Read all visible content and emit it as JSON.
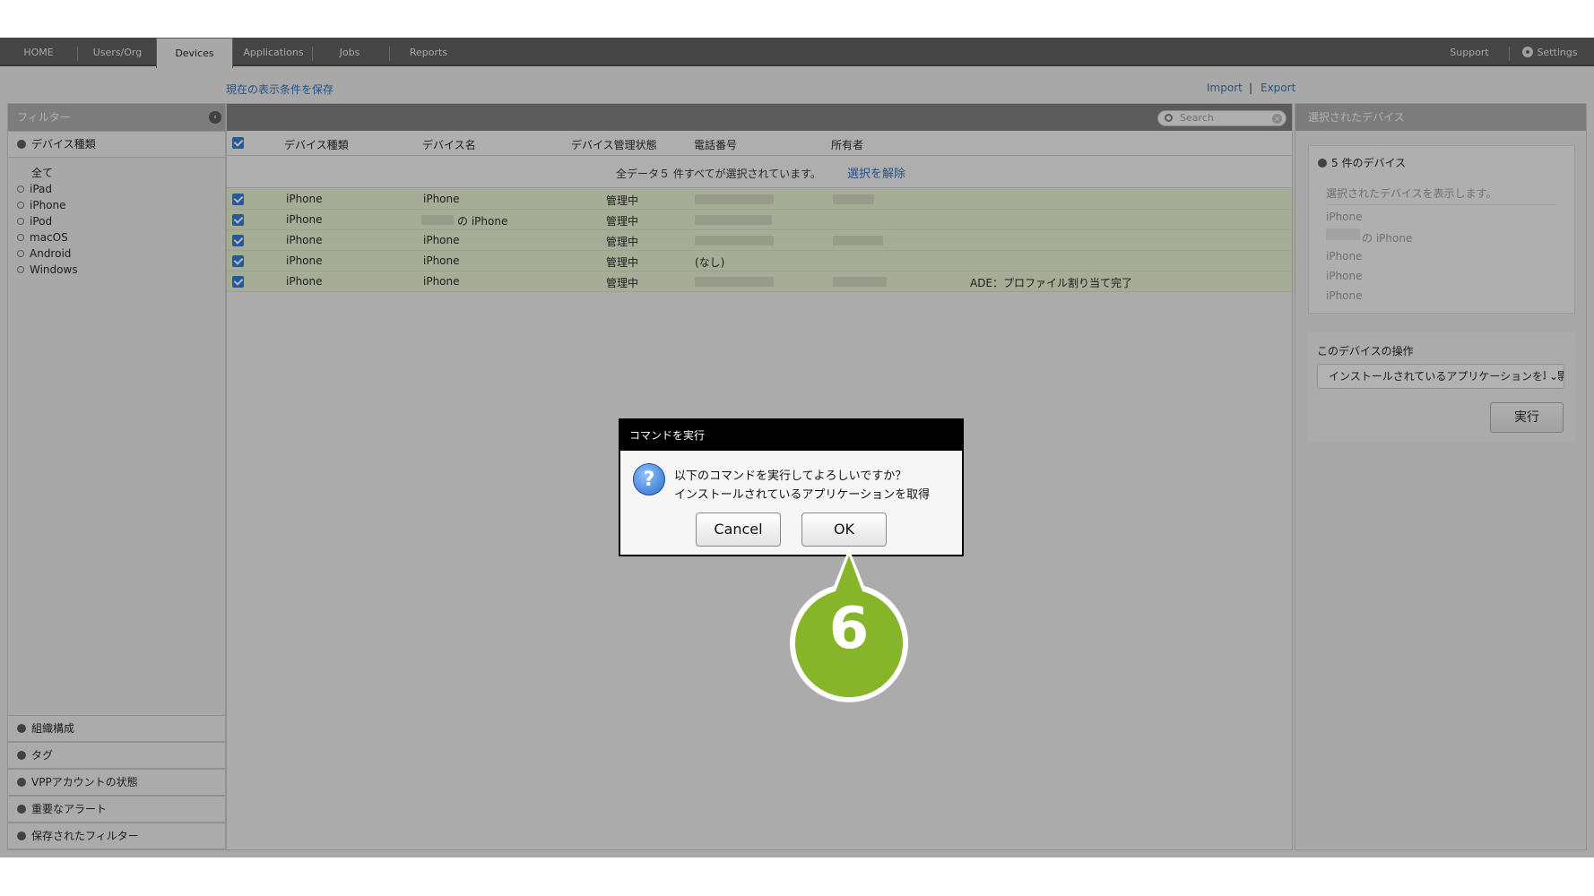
{
  "nav": {
    "tabs": [
      "HOME",
      "Users/Org",
      "Devices",
      "Applications",
      "Jobs",
      "Reports"
    ],
    "active": "Devices",
    "support": "Support",
    "settings": "Settings"
  },
  "toolbar_links": {
    "save_view": "現在の表示条件を保存",
    "import": "Import",
    "sep": "|",
    "export": "Export"
  },
  "filter": {
    "title": "フィルター",
    "device_type_header": "デバイス種類",
    "types": [
      "全て",
      "iPad",
      "iPhone",
      "iPod",
      "macOS",
      "Android",
      "Windows"
    ],
    "bottom_sections": [
      "組織構成",
      "タグ",
      "VPPアカウントの状態",
      "重要なアラート",
      "保存されたフィルター"
    ]
  },
  "table": {
    "search_placeholder": "Search",
    "columns": [
      "デバイス種類",
      "デバイス名",
      "デバイス管理状態",
      "電話番号",
      "所有者"
    ],
    "banner_text": "全データ５ 件すべてが選択されています。",
    "banner_link": "選択を解除",
    "rows": [
      {
        "type": "iPhone",
        "name": "iPhone",
        "status": "管理中",
        "phone": "",
        "note": ""
      },
      {
        "type": "iPhone",
        "name": "の iPhone",
        "status": "管理中",
        "phone": "",
        "note": ""
      },
      {
        "type": "iPhone",
        "name": "iPhone",
        "status": "管理中",
        "phone": "",
        "note": ""
      },
      {
        "type": "iPhone",
        "name": "iPhone",
        "status": "管理中",
        "phone": "(なし)",
        "note": ""
      },
      {
        "type": "iPhone",
        "name": "iPhone",
        "status": "管理中",
        "phone": "",
        "note": "ADE：プロファイル割り当て完了"
      }
    ]
  },
  "right": {
    "title": "選択されたデバイス",
    "count_label": "5 件のデバイス",
    "show_label": "選択されたデバイスを表示します。",
    "devices": [
      "iPhone",
      "の iPhone",
      "iPhone",
      "iPhone",
      "iPhone"
    ],
    "ops_title": "このデバイスの操作",
    "ops_selected": "インストールされているアプリケーションを取得",
    "run_button": "実行"
  },
  "dialog": {
    "title": "コマンドを実行",
    "line1": "以下のコマンドを実行してよろしいですか？",
    "line2": "インストールされているアプリケーションを取得",
    "cancel": "Cancel",
    "ok": "OK"
  },
  "step_badge": "6",
  "colors": {
    "accent_green": "#86b52a",
    "link_blue": "#2a6fb5",
    "checkbox_blue": "#2e77d0"
  }
}
